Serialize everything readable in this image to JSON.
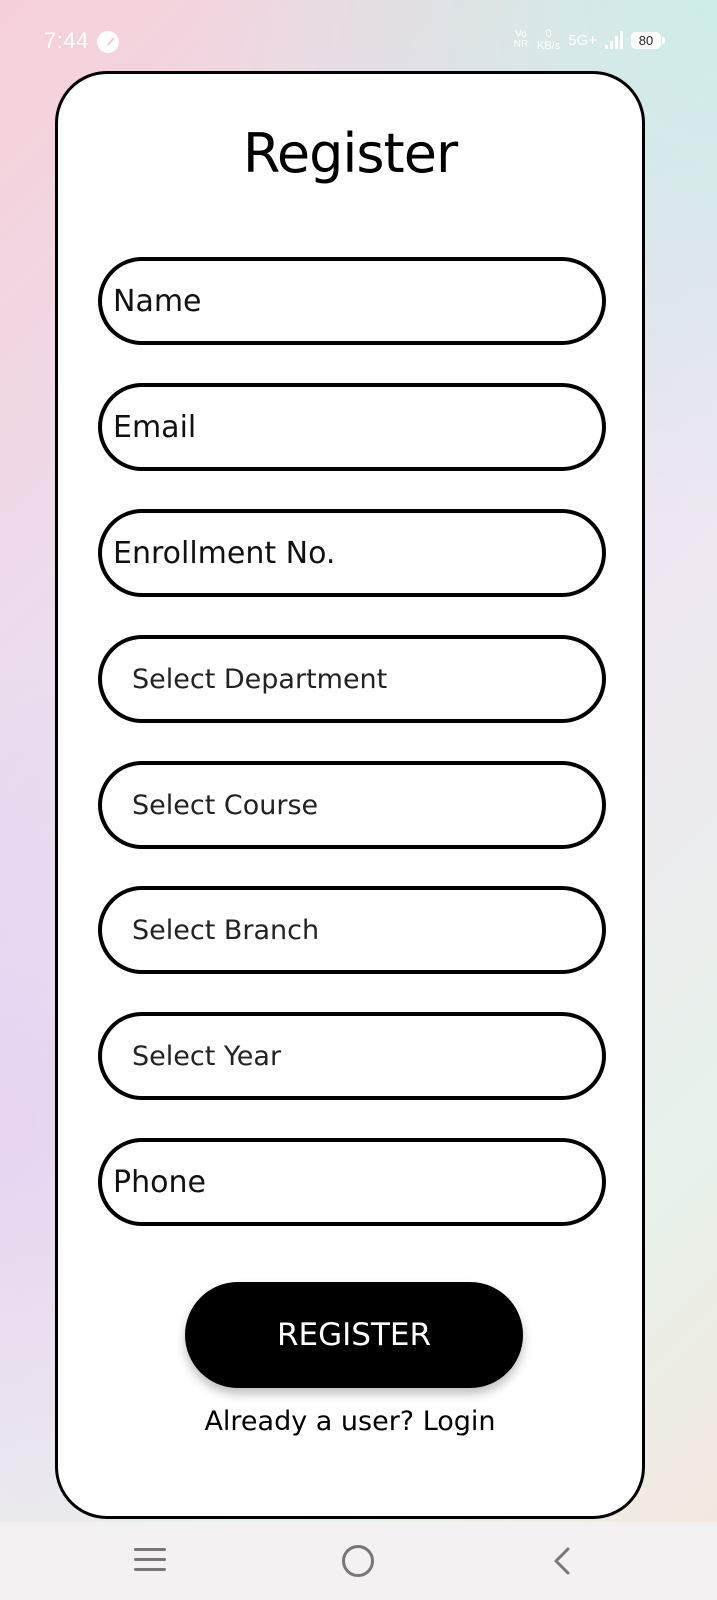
{
  "status_bar": {
    "time": "7:44",
    "volte_top": "Vo",
    "volte_bottom": "NR",
    "net_speed_value": "0",
    "net_speed_unit": "KB/s",
    "network": "5G+",
    "battery": "80"
  },
  "form": {
    "title": "Register",
    "fields": [
      {
        "placeholder": "Name"
      },
      {
        "placeholder": "Email"
      },
      {
        "placeholder": "Enrollment No."
      },
      {
        "placeholder": "Select Department"
      },
      {
        "placeholder": "Select Course"
      },
      {
        "placeholder": "Select Branch"
      },
      {
        "placeholder": "Select Year"
      },
      {
        "placeholder": "Phone"
      }
    ],
    "submit_label": "REGISTER",
    "login_prompt": "Already a user? Login"
  },
  "nav_bar": {
    "icons": [
      "menu-icon",
      "home-icon",
      "back-icon"
    ]
  },
  "colors": {
    "card_border": "#000000",
    "button_bg": "#000000",
    "button_text": "#ffffff"
  }
}
